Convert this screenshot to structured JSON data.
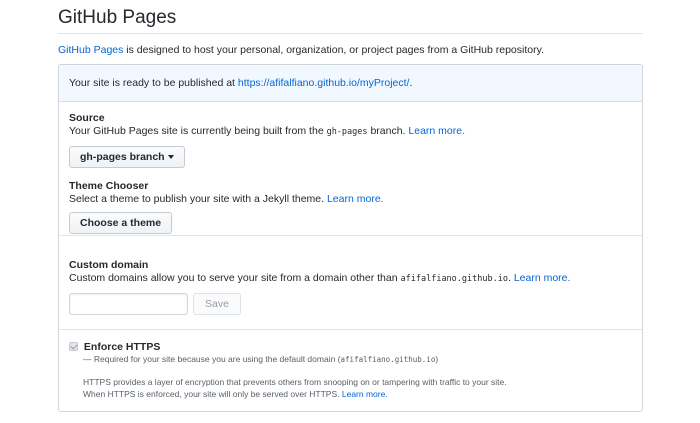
{
  "page": {
    "title": "GitHub Pages",
    "intro": {
      "link": "GitHub Pages",
      "text": " is designed to host your personal, organization, or project pages from a GitHub repository."
    }
  },
  "flash": {
    "text": "Your site is ready to be published at ",
    "url": "https://afifalfiano.github.io/myProject/",
    "suffix": "."
  },
  "source": {
    "heading": "Source",
    "desc_before": "Your GitHub Pages site is currently being built from the ",
    "branch_code": "gh-pages",
    "desc_after": " branch. ",
    "learn_more": "Learn more.",
    "branch_button": "gh-pages branch"
  },
  "theme": {
    "heading": "Theme Chooser",
    "desc": "Select a theme to publish your site with a Jekyll theme. ",
    "learn_more": "Learn more.",
    "button": "Choose a theme"
  },
  "custom_domain": {
    "heading": "Custom domain",
    "desc": "Custom domains allow you to serve your site from a domain other than ",
    "domain_code": "afifalfiano.github.io",
    "desc_after": ". ",
    "learn_more": "Learn more.",
    "input_value": "",
    "save_button": "Save"
  },
  "https": {
    "checkbox_label": "Enforce HTTPS",
    "checked": true,
    "disabled": true,
    "required_text": "— Required for your site because you are using the default domain (",
    "required_code": "afifalfiano.github.io",
    "required_after": ")",
    "note_line1": "HTTPS provides a layer of encryption that prevents others from snooping on or tampering with traffic to your site.",
    "note_line2": "When HTTPS is enforced, your site will only be served over HTTPS. ",
    "learn_more": "Learn more."
  }
}
